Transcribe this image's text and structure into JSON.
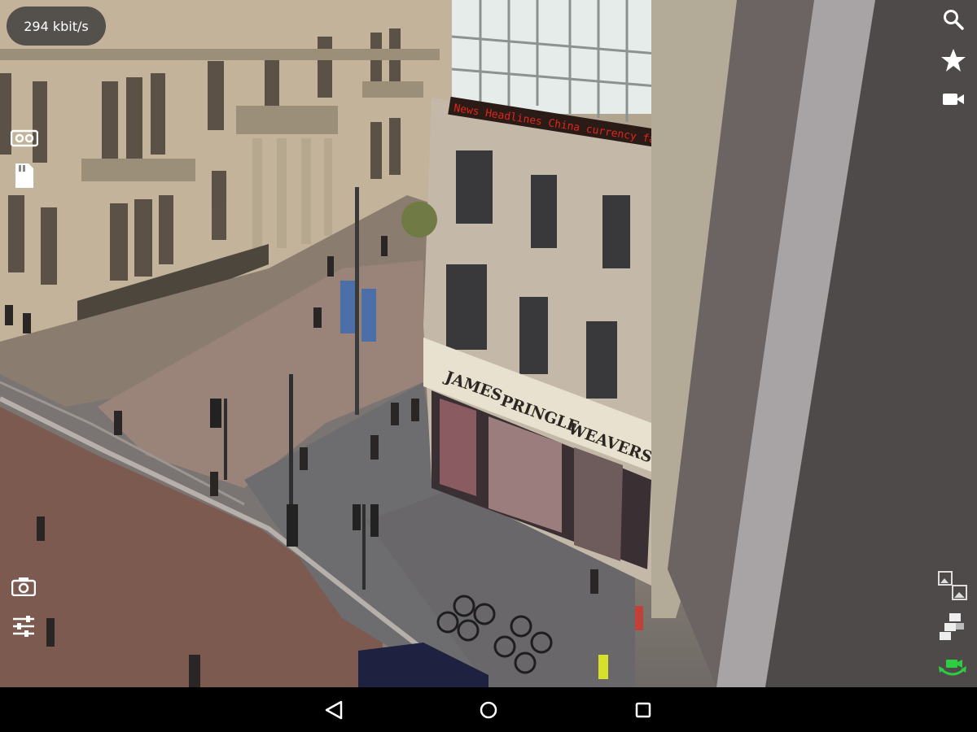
{
  "stream": {
    "bitrate_label": "294 kbit/s"
  },
  "scene": {
    "led_ticker": "News Headlines   China currency falls for second day   Pape",
    "shop_sign_line1": "JAMES",
    "shop_sign_line2": "PRINGLE",
    "shop_sign_line3": "WEAVERS"
  },
  "icons": {
    "top_right": [
      "search-icon",
      "star-icon",
      "video-camera-icon"
    ],
    "left": [
      "vr-goggles-icon",
      "sd-card-icon",
      "camera-icon",
      "sliders-icon"
    ],
    "bottom_right": [
      "picture-in-picture-icon",
      "multi-camera-icon",
      "rotate-camera-icon"
    ],
    "nav": [
      "back-icon",
      "home-icon",
      "recents-icon"
    ]
  },
  "colors": {
    "accent_green": "#2ecc40",
    "led_red": "#e0261b",
    "overlay_bg": "#3c3c3c"
  }
}
